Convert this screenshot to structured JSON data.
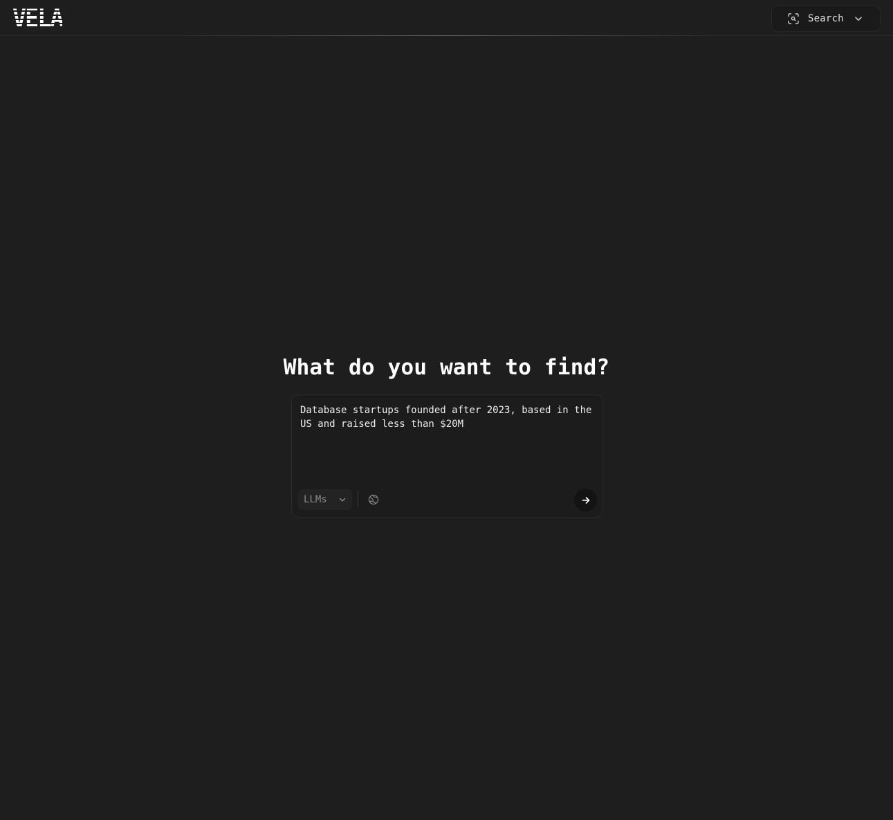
{
  "header": {
    "logo_text": "VELA",
    "mode_selector": {
      "label": "Search",
      "icon": "scan-search-icon"
    }
  },
  "main": {
    "title": "What do you want to find?",
    "composer": {
      "query": "Database startups founded after 2023, based in the\nUS and raised less than $20M",
      "model_select": {
        "selected": "LLMs"
      },
      "web_toggle_icon": "globe-icon",
      "submit_icon": "arrow-right-icon"
    }
  },
  "colors": {
    "background": "#1e1e1e",
    "text": "#ffffff",
    "muted": "#8a8a8a"
  }
}
